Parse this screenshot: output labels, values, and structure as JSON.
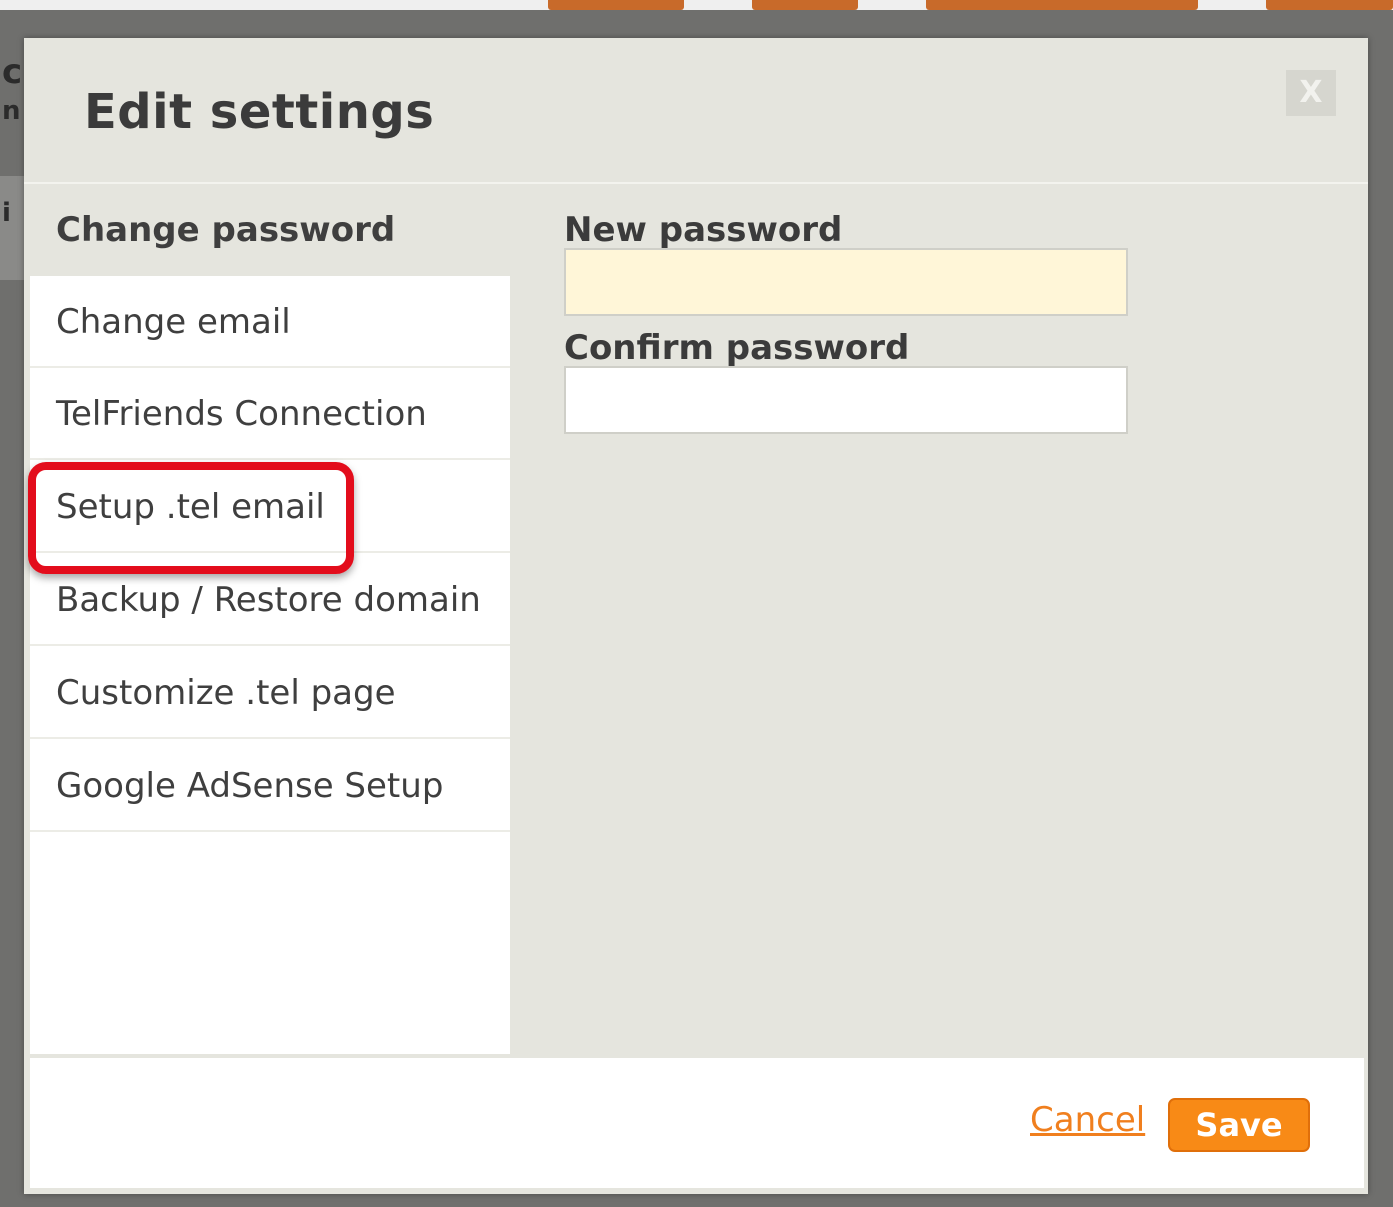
{
  "dialog": {
    "title": "Edit settings",
    "close_label": "X"
  },
  "menu": {
    "items": [
      {
        "label": "Change password",
        "active": true
      },
      {
        "label": "Change email"
      },
      {
        "label": "TelFriends Connection"
      },
      {
        "label": "Setup .tel email",
        "highlighted": true
      },
      {
        "label": "Backup / Restore domain"
      },
      {
        "label": "Customize .tel page"
      },
      {
        "label": "Google AdSense Setup"
      }
    ]
  },
  "form": {
    "new_password": {
      "label": "New password",
      "value": ""
    },
    "confirm_password": {
      "label": "Confirm password",
      "value": ""
    }
  },
  "footer": {
    "cancel_label": "Cancel",
    "save_label": "Save"
  },
  "colors": {
    "accent": "#f88a16",
    "highlight_ring": "#e30d1c",
    "dialog_bg": "#e5e5de",
    "focused_input_bg": "#fff6d8"
  }
}
